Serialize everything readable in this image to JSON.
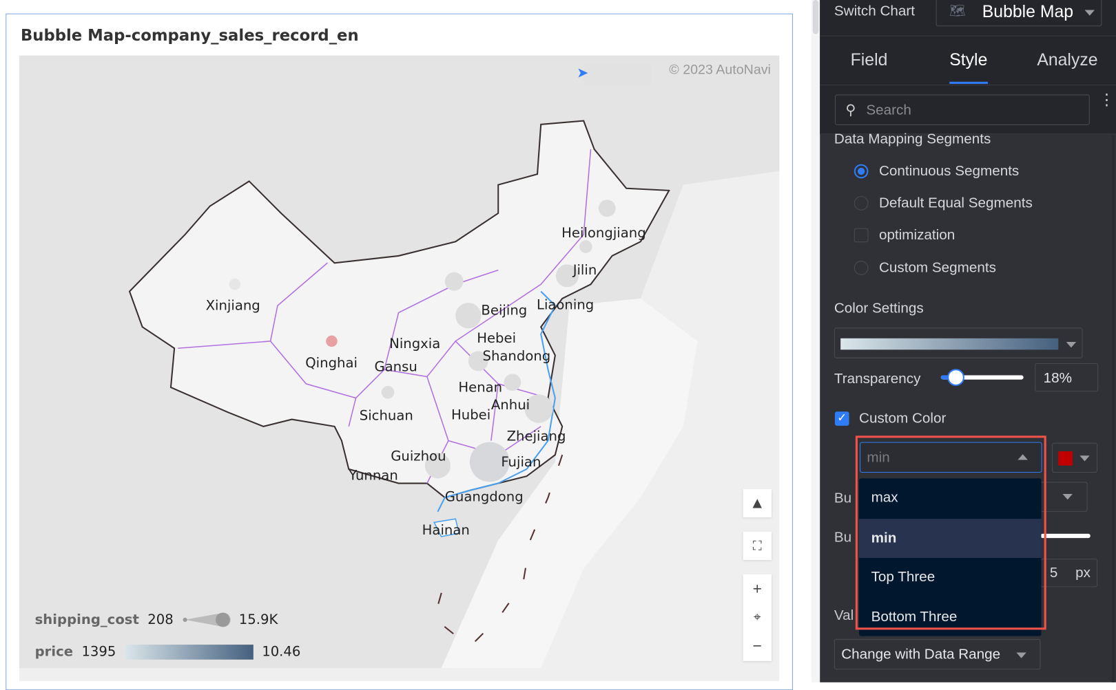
{
  "chart": {
    "title": "Bubble Map-company_sales_record_en",
    "copyright": "© 2023 AutoNavi",
    "provinces": [
      "Heilongjiang",
      "Jilin",
      "Liaoning",
      "Beijing",
      "Hebei",
      "Shandong",
      "Xinjiang",
      "Ningxia",
      "Qinghai",
      "Gansu",
      "Henan",
      "Anhui",
      "Sichuan",
      "Hubei",
      "Zhejiang",
      "Guizhou",
      "Fujian",
      "Yunnan",
      "Guangdong",
      "Hainan"
    ],
    "legend": {
      "size_field": "shipping_cost",
      "size_min": "208",
      "size_max": "15.9K",
      "color_field": "price",
      "color_min": "1395",
      "color_max": "10.46",
      "color_gradient": [
        "#dbe6ea",
        "#45607f"
      ]
    },
    "highlight_color": "#e8a0a0",
    "controls": [
      "warning-icon",
      "fit-view-icon",
      "zoom-in-icon",
      "locate-icon",
      "zoom-out-icon"
    ]
  },
  "panel": {
    "switch_chart_label": "Switch Chart",
    "chart_type": "Bubble Map",
    "tabs": [
      {
        "label": "Field"
      },
      {
        "label": "Style",
        "active": true
      },
      {
        "label": "Analyze"
      }
    ],
    "search_placeholder": "Search",
    "data_mapping": {
      "title": "Data Mapping Segments",
      "options": [
        {
          "label": "Continuous Segments",
          "selected": true
        },
        {
          "label": "Default Equal Segments",
          "selected": false
        },
        {
          "label": "optimization",
          "checkbox": true,
          "checked": false
        },
        {
          "label": "Custom Segments",
          "selected": false
        }
      ]
    },
    "color_settings": {
      "title": "Color Settings",
      "gradient": [
        "#dbe6ea",
        "#45607f"
      ],
      "transparency_label": "Transparency",
      "transparency": "18%",
      "transparency_value": 18,
      "custom_color_label": "Custom Color",
      "custom_color_checked": true,
      "custom_select_value": "min",
      "custom_swatch": "#c00000",
      "dropdown_options": [
        {
          "label": "max"
        },
        {
          "label": "min",
          "selected": true
        },
        {
          "label": "Top Three"
        },
        {
          "label": "Bottom Three"
        }
      ]
    },
    "hidden_rows": {
      "bubble_a": "Bu",
      "bubble_b": "Bu",
      "value": "Val",
      "px_value": "5",
      "px_unit": "px"
    },
    "range_select": "Change with Data Range",
    "accent": "#2f7cf6",
    "highlight_border": "#f0524a"
  }
}
